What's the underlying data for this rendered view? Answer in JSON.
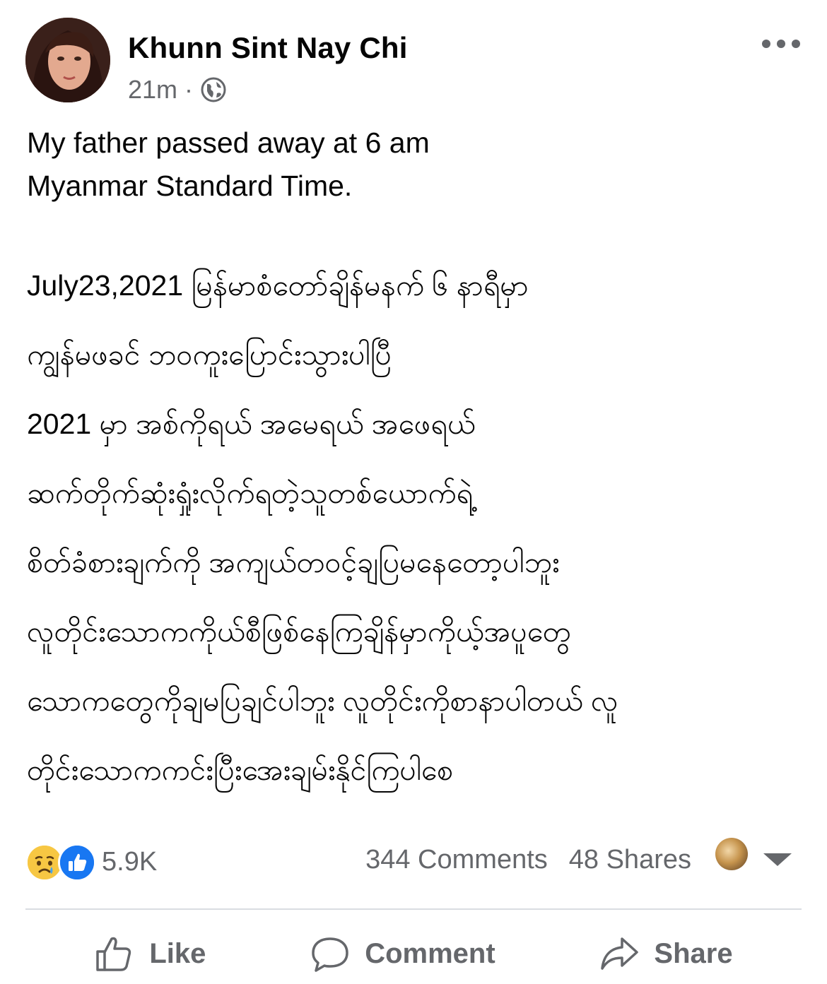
{
  "post": {
    "author": "Khunn Sint Nay Chi",
    "time": "21m",
    "separator": "·",
    "privacy_icon": "globe-icon",
    "menu_icon": "more-options-icon",
    "text_en_line1": "My father passed away at 6 am",
    "text_en_line2": "Myanmar Standard Time.",
    "text_my": [
      "July23,2021 မြန်မာစံတော်ချိန်မနက် ၆ နာရီမှာ",
      "ကျွန်မဖခင် ဘဝကူးပြောင်းသွားပါပြီ",
      "2021 မှာ အစ်ကိုရယ် အမေရယ် အဖေရယ်",
      "ဆက်တိုက်ဆုံးရှုံးလိုက်ရတဲ့သူတစ်ယောက်ရဲ့",
      "စိတ်ခံစားချက်ကို အကျယ်တဝင့်ချပြမနေတော့ပါဘူး",
      "လူတိုင်းသောကကိုယ်စီဖြစ်နေကြချိန်မှာကိုယ့်အပူတွေ",
      "သောကတွေကိုချမပြချင်ပါဘူး လူတိုင်းကိုစာနာပါတယ် လူ",
      "တိုင်းသောကကင်းပြီးအေးချမ်းနိုင်ကြပါစေ"
    ]
  },
  "stats": {
    "reaction_icons": [
      "sad-icon",
      "like-icon"
    ],
    "reactions": "5.9K",
    "comments": "344 Comments",
    "shares": "48 Shares"
  },
  "actions": {
    "like": "Like",
    "comment": "Comment",
    "share": "Share"
  },
  "colors": {
    "text": "#050505",
    "secondary": "#65676b",
    "like_blue": "#1877f2",
    "sad_yellow": "#f7c743",
    "divider": "#dadde1"
  }
}
